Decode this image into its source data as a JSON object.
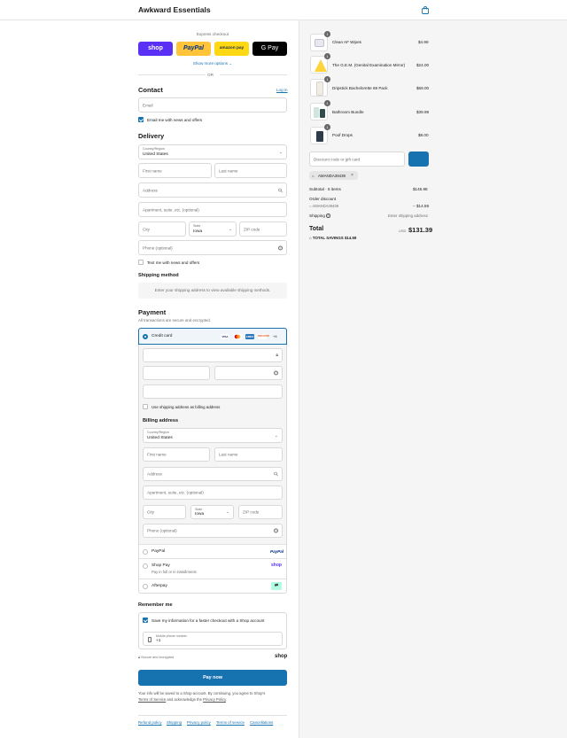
{
  "header": {
    "brand": "Awkward Essentials",
    "cart_icon": "shopping-bag-icon"
  },
  "express": {
    "title": "Express checkout",
    "buttons": [
      {
        "label": "shop",
        "color": "#5a31f4"
      },
      {
        "label": "PayPal",
        "color": "#ffc439"
      },
      {
        "label": "amazon pay",
        "color": "#ffd814"
      },
      {
        "label": "G Pay",
        "color": "#000000"
      }
    ],
    "show_more": "Show more options",
    "or": "OR"
  },
  "contact": {
    "title": "Contact",
    "login": "Log in",
    "email_placeholder": "Email",
    "news_label": "Email me with news and offers"
  },
  "delivery": {
    "title": "Delivery",
    "country_label": "Country/Region",
    "country_value": "United States",
    "first_name": "First name",
    "last_name": "Last name",
    "address": "Address",
    "apartment": "Apartment, suite, etc. (optional)",
    "city": "City",
    "state_label": "State",
    "state_value": "Iowa",
    "zip": "ZIP code",
    "phone": "Phone (optional)",
    "text_me": "Text me with news and offers"
  },
  "shipping_method": {
    "title": "Shipping method",
    "notice": "Enter your shipping address to view available shipping methods."
  },
  "payment": {
    "title": "Payment",
    "subtitle": "All transactions are secure and encrypted.",
    "credit_card_label": "Credit card",
    "card_brands": [
      "VISA",
      "MC",
      "AMEX",
      "DISCOVER"
    ],
    "more_cards": "+4",
    "use_shipping": "Use shipping address as billing address",
    "paypal": "PayPal",
    "paypal_logo": "PayPal",
    "shop_pay": "Shop Pay",
    "shop_pay_sub": "Pay in full or in installments",
    "shop_pay_logo": "shop",
    "afterpay": "Afterpay"
  },
  "billing": {
    "title": "Billing address",
    "country_label": "Country/Region",
    "country_value": "United States",
    "first_name": "First name",
    "last_name": "Last name",
    "address": "Address",
    "apartment": "Apartment, suite, etc. (optional)",
    "city": "City",
    "state_label": "State",
    "state_value": "Iowa",
    "zip": "ZIP code",
    "phone": "Phone (optional)"
  },
  "remember": {
    "title": "Remember me",
    "save_label": "Save my information for a faster checkout with a Shop account",
    "mobile_label": "Mobile phone number",
    "mobile_value": "+1",
    "secure": "Secure and encrypted",
    "shop_logo": "shop"
  },
  "pay_now": "Pay now",
  "legal": {
    "text1": "Your info will be saved to a Shop account. By continuing, you agree to Shop's",
    "terms": "Terms of Service",
    "text2": "and acknowledge the",
    "privacy": "Privacy Policy",
    "end": "."
  },
  "footer_links": [
    "Refund policy",
    "Shipping",
    "Privacy policy",
    "Terms of service",
    "Cancellations"
  ],
  "cart": {
    "items": [
      {
        "qty": "1",
        "name": "Clean AF Wipes",
        "price": "$4.99"
      },
      {
        "qty": "1",
        "name": "The G.E.M. (Genital Examination Mirror)",
        "price": "$24.00"
      },
      {
        "qty": "1",
        "name": "Dripstick Bachelorette 69 Pack",
        "price": "$69.00"
      },
      {
        "qty": "1",
        "name": "Bathroom Bundle",
        "price": "$39.99"
      },
      {
        "qty": "1",
        "name": "Poof Drops",
        "price": "$8.00"
      }
    ],
    "discount_placeholder": "Discount code or gift card",
    "applied_code": "AMANDA39439",
    "subtotal_label": "Subtotal · 5 items",
    "subtotal_value": "$145.98",
    "order_discount": "Order discount",
    "discount_code": "AMANDA39439",
    "discount_value": "− $14.59",
    "shipping_label": "Shipping",
    "shipping_value": "Enter shipping address",
    "total_label": "Total",
    "currency": "USD",
    "total_value": "$131.39",
    "savings_label": "TOTAL SAVINGS",
    "savings_value": "$14.59"
  }
}
